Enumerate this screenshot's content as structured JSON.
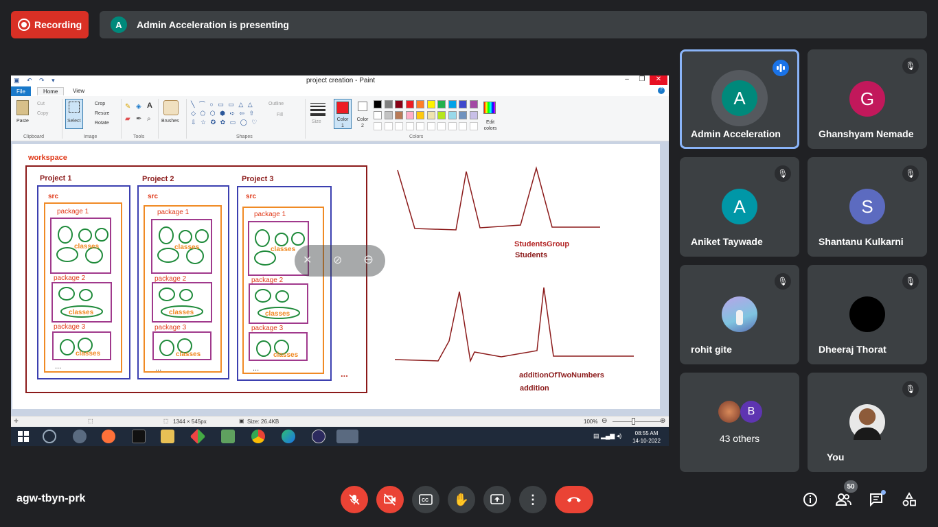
{
  "top_bar": {
    "recording_label": "Recording",
    "presenter_initial": "A",
    "presenting_text": "Admin Acceleration is presenting"
  },
  "paint": {
    "window_title": "project creation - Paint",
    "tabs": [
      "File",
      "Home",
      "View"
    ],
    "ribbon": {
      "paste": "Paste",
      "cut": "Cut",
      "copy": "Copy",
      "clipboard": "Clipboard",
      "select": "Select",
      "crop": "Crop",
      "resize": "Resize",
      "rotate": "Rotate",
      "image": "Image",
      "tools": "Tools",
      "brushes": "Brushes",
      "outline": "Outline",
      "fill": "Fill",
      "shapes": "Shapes",
      "size": "Size",
      "color1": "Color 1",
      "color2": "Color 2",
      "edit_colors": "Edit colors",
      "colors": "Colors"
    },
    "palette": [
      "#000000",
      "#7f7f7f",
      "#880015",
      "#ed1c24",
      "#ff7f27",
      "#fff200",
      "#22b14c",
      "#00a2e8",
      "#3f48cc",
      "#a349a4",
      "#ffffff",
      "#c3c3c3",
      "#b97a57",
      "#ffaec9",
      "#ffc90e",
      "#efe4b0",
      "#b5e61d",
      "#99d9ea",
      "#7092be",
      "#c8bfe7"
    ],
    "canvas": {
      "workspace": "workspace",
      "projects": [
        {
          "title": "Project 1",
          "src": "src",
          "pkg1": "package 1",
          "pkg2": "package 2",
          "pkg3": "package 3",
          "classes": "classes",
          "more": "..."
        },
        {
          "title": "Project 2",
          "src": "src",
          "pkg1": "package 1",
          "pkg2": "package 2",
          "pkg3": "package 3",
          "classes": "classes",
          "more": "..."
        },
        {
          "title": "Project 3",
          "src": "src",
          "pkg1": "package 1",
          "pkg2": "package 2",
          "pkg3": "package 3",
          "classes": "classes",
          "more": "..."
        }
      ],
      "workspace_more": "...",
      "label_top_1": "StudentsGroup",
      "label_top_2": "Students",
      "label_bottom_1": "additionOfTwoNumbers",
      "label_bottom_2": "addition"
    },
    "status": {
      "dimensions": "1344 × 545px",
      "size": "Size: 26.4KB",
      "zoom": "100%"
    },
    "taskbar": {
      "time": "08:55 AM",
      "date": "14-10-2022"
    }
  },
  "participants": [
    {
      "name": "Admin Acceleration",
      "initial": "A",
      "color": "#00897b",
      "active": true,
      "speaking": true
    },
    {
      "name": "Ghanshyam Nemade",
      "initial": "G",
      "color": "#c2185b"
    },
    {
      "name": "Aniket Taywade",
      "initial": "A",
      "color": "#0097a7"
    },
    {
      "name": "Shantanu Kulkarni",
      "initial": "S",
      "color": "#5c6bc0"
    },
    {
      "name": "rohit gite",
      "initial": "",
      "color": "#7986cb"
    },
    {
      "name": "Dheeraj Thorat",
      "initial": "",
      "color": "#000000"
    },
    {
      "name": "43 others",
      "initial": "B",
      "color": "#5e35b1"
    },
    {
      "name": "You",
      "initial": "",
      "color": "#e0e0e0"
    }
  ],
  "bottom_bar": {
    "meeting_code": "agw-tbyn-prk",
    "people_count": "50"
  }
}
